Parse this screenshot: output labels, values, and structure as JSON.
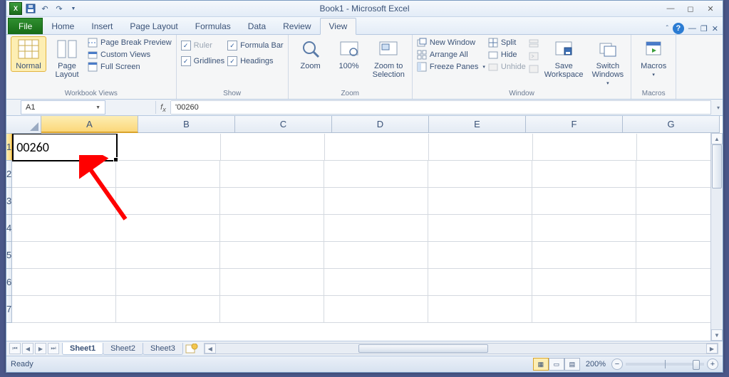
{
  "title": "Book1 - Microsoft Excel",
  "tabs": {
    "file": "File",
    "home": "Home",
    "insert": "Insert",
    "pagelayout": "Page Layout",
    "formulas": "Formulas",
    "data": "Data",
    "review": "Review",
    "view": "View"
  },
  "ribbon": {
    "views": {
      "normal": "Normal",
      "pagelayout": "Page\nLayout",
      "pagebreak": "Page Break Preview",
      "custom": "Custom Views",
      "full": "Full Screen",
      "group": "Workbook Views"
    },
    "show": {
      "ruler": "Ruler",
      "formulabar": "Formula Bar",
      "gridlines": "Gridlines",
      "headings": "Headings",
      "group": "Show"
    },
    "zoom": {
      "zoom": "Zoom",
      "hundred": "100%",
      "tosel": "Zoom to\nSelection",
      "group": "Zoom"
    },
    "window": {
      "neww": "New Window",
      "arr": "Arrange All",
      "freeze": "Freeze Panes",
      "split": "Split",
      "hide": "Hide",
      "unhide": "Unhide",
      "save": "Save\nWorkspace",
      "switch": "Switch\nWindows",
      "group": "Window"
    },
    "macros": {
      "macros": "Macros",
      "group": "Macros"
    }
  },
  "namebox": "A1",
  "formula": "'00260",
  "columns": [
    "A",
    "B",
    "C",
    "D",
    "E",
    "F",
    "G"
  ],
  "rows": [
    "1",
    "2",
    "3",
    "4",
    "5",
    "6",
    "7"
  ],
  "cellA1": "00260",
  "sheets": [
    "Sheet1",
    "Sheet2",
    "Sheet3"
  ],
  "status": {
    "ready": "Ready",
    "zoom": "200%"
  }
}
